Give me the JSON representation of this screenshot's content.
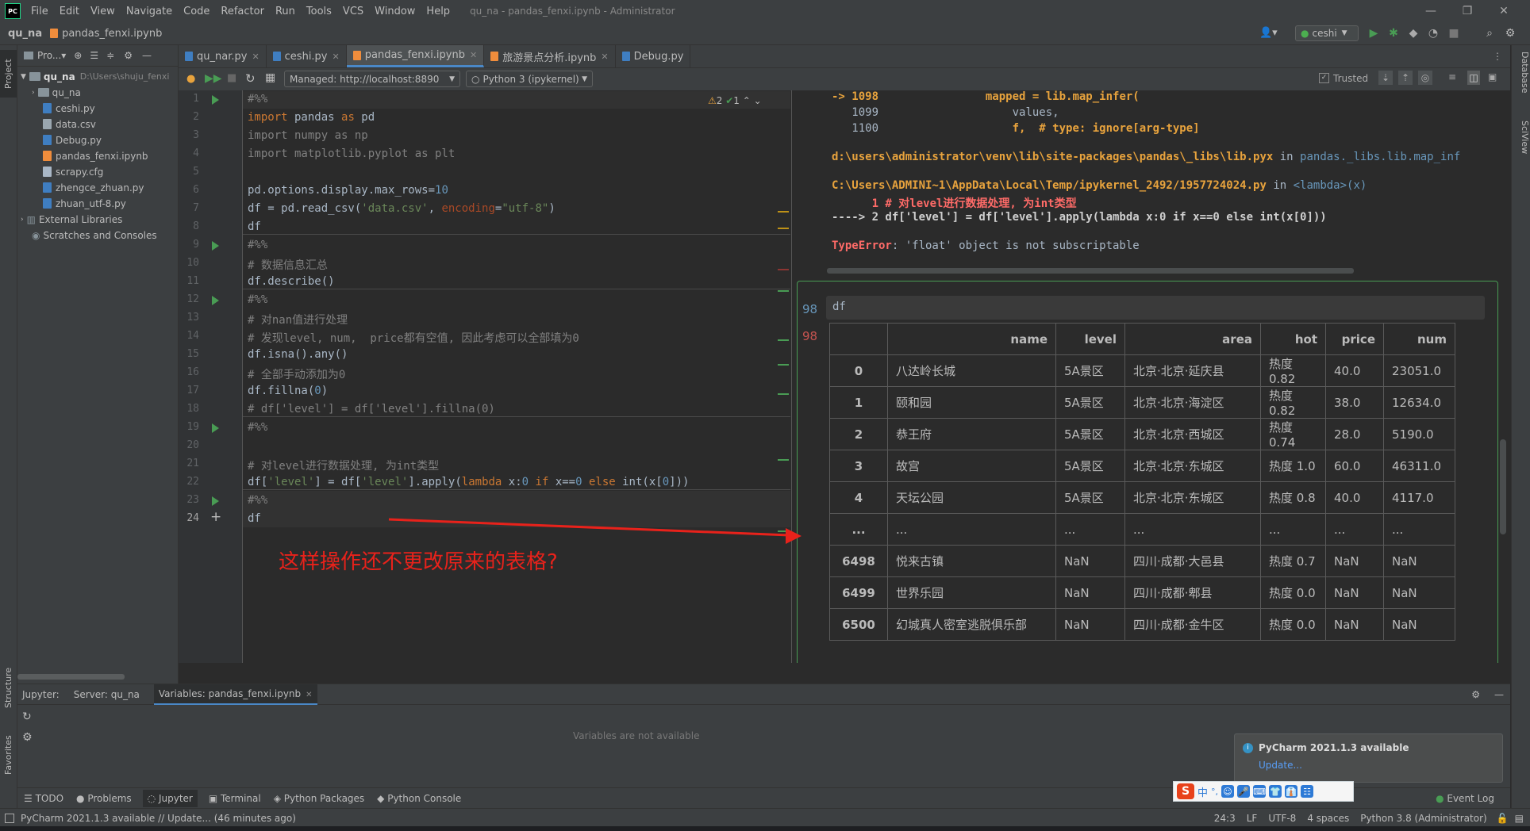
{
  "app": {
    "logo": "PC",
    "menu": [
      "File",
      "Edit",
      "View",
      "Navigate",
      "Code",
      "Refactor",
      "Run",
      "Tools",
      "VCS",
      "Window",
      "Help"
    ],
    "window_title": "qu_na - pandas_fenxi.ipynb - Administrator",
    "window_controls": [
      "—",
      "❐",
      "✕"
    ]
  },
  "navbar": {
    "project": "qu_na",
    "file": "pandas_fenxi.ipynb",
    "run_config": "ceshi"
  },
  "project_panel": {
    "title": "Pro...▾",
    "root": "qu_na",
    "root_path": "D:\\Users\\shuju_fenxi",
    "items": [
      {
        "name": "qu_na",
        "type": "folder"
      },
      {
        "name": "ceshi.py",
        "type": "py"
      },
      {
        "name": "data.csv",
        "type": "csv"
      },
      {
        "name": "Debug.py",
        "type": "py"
      },
      {
        "name": "pandas_fenxi.ipynb",
        "type": "nb"
      },
      {
        "name": "scrapy.cfg",
        "type": "cfg"
      },
      {
        "name": "zhengce_zhuan.py",
        "type": "py"
      },
      {
        "name": "zhuan_utf-8.py",
        "type": "py"
      }
    ],
    "external": "External Libraries",
    "scratches": "Scratches and Consoles"
  },
  "tabs": [
    {
      "label": "qu_nar.py",
      "active": false
    },
    {
      "label": "ceshi.py",
      "active": false
    },
    {
      "label": "pandas_fenxi.ipynb",
      "active": true
    },
    {
      "label": "旅游景点分析.ipynb",
      "active": false
    },
    {
      "label": "Debug.py",
      "active": false
    }
  ],
  "notebook_toolbar": {
    "server": "Managed: http://localhost:8890",
    "kernel": "Python 3 (ipykernel)",
    "trusted": "Trusted"
  },
  "inspections": {
    "warnings": "2",
    "ok": "1"
  },
  "code_lines": [
    "#%%",
    "import pandas as pd",
    "import numpy as np",
    "import matplotlib.pyplot as plt",
    "",
    "pd.options.display.max_rows=10",
    "df = pd.read_csv('data.csv', encoding=\"utf-8\")",
    "df",
    "#%%",
    "# 数据信息汇总",
    "df.describe()",
    "#%%",
    "# 对nan值进行处理",
    "# 发现level, num,  price都有空值, 因此考虑可以全部填为0",
    "df.isna().any()",
    "# 全部手动添加为0",
    "df.fillna(0)",
    "# df['level'] = df['level'].fillna(0)",
    "#%%",
    "",
    "# 对level进行数据处理, 为int类型",
    "df['level'] = df['level'].apply(lambda x:0 if x==0 else int(x[0]))",
    "#%%",
    "df"
  ],
  "annotation": "这样操作还不更改原来的表格?",
  "traceback": {
    "line1_arrow": "-> 1098",
    "line1_code": "mapped = lib.map_infer(",
    "line2_no": "1099",
    "line2_code": "values,",
    "line3_no": "1100",
    "line3_code": "f,  # type: ignore[arg-type]",
    "path1": "d:\\users\\administrator\\venv\\lib\\site-packages\\pandas\\_libs\\lib.pyx",
    "path1_in": "in",
    "path1_fn": "pandas._libs.lib.map_inf",
    "path2": "C:\\Users\\ADMINI~1\\AppData\\Local\\Temp/ipykernel_2492/1957724024.py",
    "path2_in": "in",
    "path2_fn": "<lambda>(x)",
    "ctx1": "      1 # 对level进行数据处理, 为int类型",
    "ctx2": "----> 2 df['level'] = df['level'].apply(lambda x:0 if x==0 else int(x[0]))",
    "error_type": "TypeError",
    "error_msg": ": 'float' object is not subscriptable"
  },
  "output_cell": {
    "in_no": "98",
    "out_no": "98",
    "input": "df",
    "columns": [
      "",
      "name",
      "level",
      "area",
      "hot",
      "price",
      "num"
    ],
    "rows": [
      [
        "0",
        "八达岭长城",
        "5A景区",
        "北京·北京·延庆县",
        "热度 0.82",
        "40.0",
        "23051.0"
      ],
      [
        "1",
        "颐和园",
        "5A景区",
        "北京·北京·海淀区",
        "热度 0.82",
        "38.0",
        "12634.0"
      ],
      [
        "2",
        "恭王府",
        "5A景区",
        "北京·北京·西城区",
        "热度 0.74",
        "28.0",
        "5190.0"
      ],
      [
        "3",
        "故宫",
        "5A景区",
        "北京·北京·东城区",
        "热度 1.0",
        "60.0",
        "46311.0"
      ],
      [
        "4",
        "天坛公园",
        "5A景区",
        "北京·北京·东城区",
        "热度 0.8",
        "40.0",
        "4117.0"
      ],
      [
        "...",
        "...",
        "...",
        "...",
        "...",
        "...",
        "..."
      ],
      [
        "6498",
        "悦来古镇",
        "NaN",
        "四川·成都·大邑县",
        "热度 0.7",
        "NaN",
        "NaN"
      ],
      [
        "6499",
        "世界乐园",
        "NaN",
        "四川·成都·郫县",
        "热度 0.0",
        "NaN",
        "NaN"
      ],
      [
        "6500",
        "幻城真人密室逃脱俱乐部",
        "NaN",
        "四川·成都·金牛区",
        "热度 0.0",
        "NaN",
        "NaN"
      ]
    ]
  },
  "bottom_panel": {
    "jupyter": "Jupyter:",
    "server": "Server: qu_na",
    "variables": "Variables: pandas_fenxi.ipynb",
    "empty_msg": "Variables are not available"
  },
  "tool_windows": [
    "TODO",
    "Problems",
    "Jupyter",
    "Terminal",
    "Python Packages",
    "Python Console"
  ],
  "event_log": "Event Log",
  "notification": {
    "title": "PyCharm 2021.1.3 available",
    "link": "Update..."
  },
  "status": {
    "message": "PyCharm 2021.1.3 available // Update... (46 minutes ago)",
    "position": "24:3",
    "line_sep": "LF",
    "encoding": "UTF-8",
    "indent": "4 spaces",
    "interpreter": "Python 3.8 (Administrator)"
  },
  "side_labels": {
    "project": "Project",
    "structure": "Structure",
    "favorites": "Favorites",
    "database": "Database",
    "sciview": "SciView"
  },
  "ime": {
    "brand": "S",
    "items": [
      "中",
      "°,",
      "☺",
      "🎤",
      "⌨",
      "👕",
      "👔",
      "☷"
    ]
  },
  "colors": {
    "accent": "#4a88c7",
    "run": "#499c54",
    "annotation_red": "#e8221b",
    "error_red": "#ff6b68"
  }
}
